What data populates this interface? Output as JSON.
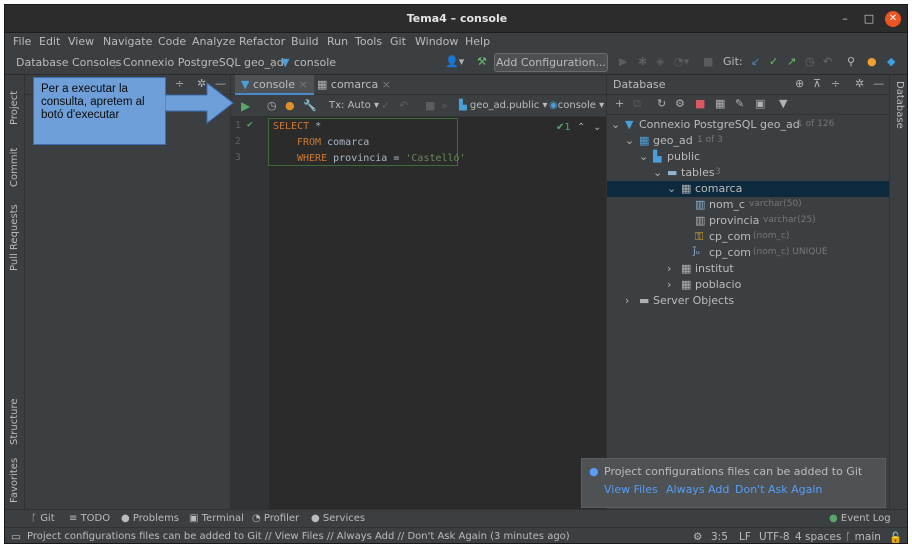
{
  "window": {
    "title": "Tema4 – console",
    "min": "–",
    "max": "□",
    "close": "✕"
  },
  "menu": [
    "File",
    "Edit",
    "View",
    "Navigate",
    "Code",
    "Analyze",
    "Refactor",
    "Build",
    "Run",
    "Tools",
    "Git",
    "Window",
    "Help"
  ],
  "breadcrumb": [
    "Database Consoles",
    "Connexio PostgreSQL geo_ad",
    "console"
  ],
  "toolbar": {
    "add_configuration": "Add Configuration...",
    "git_label": "Git:"
  },
  "side_tabs_left": [
    "Project",
    "Commit",
    "Pull Requests",
    "Structure",
    "Favorites"
  ],
  "side_tabs_right": [
    "Database"
  ],
  "callout": {
    "text": "Per a executar la consulta, apretem al botó d'executar"
  },
  "editor": {
    "tabs": [
      "console",
      "comarca"
    ],
    "tx_mode": "Tx: Auto",
    "schema": "geo_ad.public",
    "session": "console",
    "check_count": "1",
    "lines": [
      {
        "num": "1",
        "kw": "SELECT",
        "rest": " *"
      },
      {
        "num": "2",
        "kw": "FROM",
        "rest": " comarca"
      },
      {
        "num": "3",
        "kw": "WHERE",
        "rest": " provincia = ",
        "str": "'Castelló'"
      }
    ]
  },
  "database": {
    "title": "Database",
    "tree": [
      {
        "label": "Connexio PostgreSQL geo_ad",
        "badge": "1 of 126"
      },
      {
        "label": "geo_ad",
        "badge": "1 of 3"
      },
      {
        "label": "public",
        "badge": ""
      },
      {
        "label": "tables",
        "badge": "3"
      },
      {
        "label": "comarca",
        "badge": ""
      },
      {
        "label": "nom_c",
        "badge": "varchar(50)"
      },
      {
        "label": "provincia",
        "badge": "varchar(25)"
      },
      {
        "label": "cp_com",
        "badge": "(nom_c)"
      },
      {
        "label": "cp_com",
        "badge": "(nom_c) UNIQUE"
      },
      {
        "label": "institut",
        "badge": ""
      },
      {
        "label": "poblacio",
        "badge": ""
      },
      {
        "label": "Server Objects",
        "badge": ""
      }
    ]
  },
  "notification": {
    "message": "Project configurations files can be added to Git",
    "links": [
      "View Files",
      "Always Add",
      "Don't Ask Again"
    ]
  },
  "bottom_tabs": [
    "Git",
    "TODO",
    "Problems",
    "Terminal",
    "Profiler",
    "Services",
    "Event Log"
  ],
  "status": {
    "message": "Project configurations files can be added to Git // View Files // Always Add // Don't Ask Again (3 minutes ago)",
    "position": "3:5",
    "line_sep": "LF",
    "encoding": "UTF-8",
    "indent": "4 spaces",
    "branch": "main"
  },
  "colors": {
    "accent": "#4a88c7",
    "callout": "#6f9fd8",
    "keyword": "#cc7832",
    "string": "#6a8759",
    "link": "#589df6"
  }
}
